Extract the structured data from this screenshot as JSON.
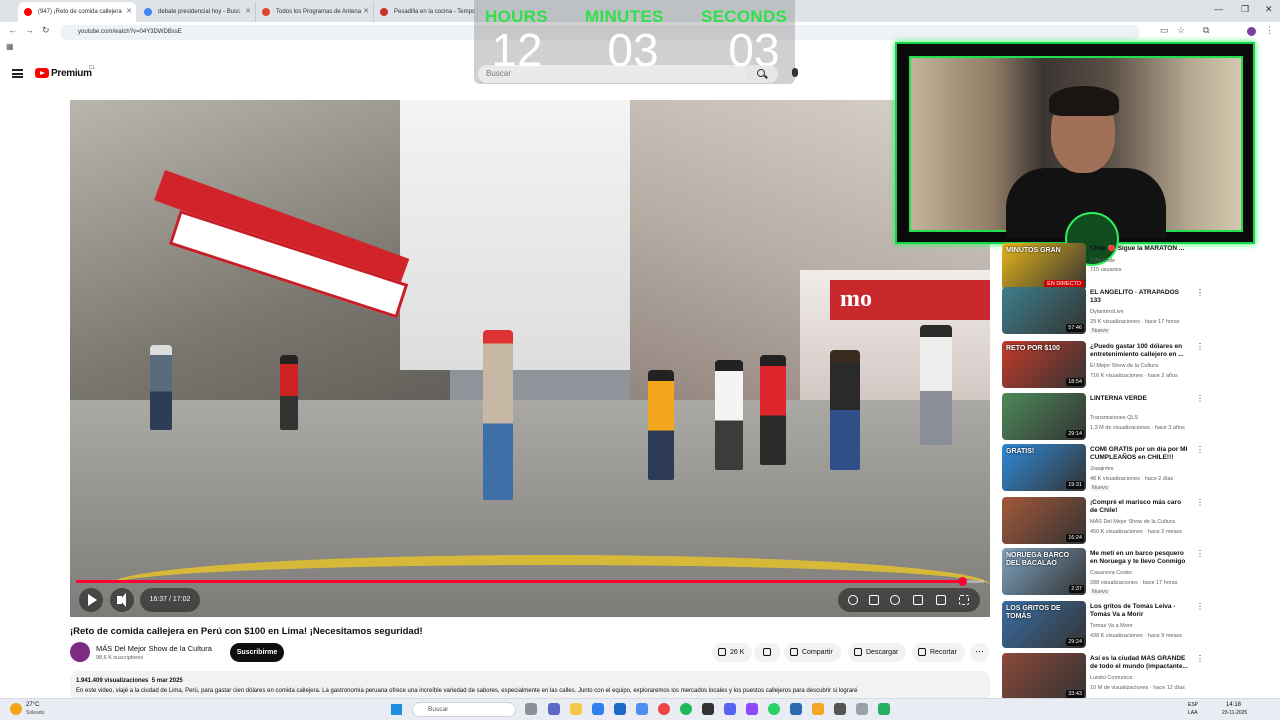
{
  "browser": {
    "tabs": [
      {
        "label": "(947) ¡Reto de comida callejera",
        "icon_color": "#ff0000",
        "active": true
      },
      {
        "label": "debate presidencial hoy - Busc",
        "icon_color": "#4285f4",
        "active": false
      },
      {
        "label": "Todos los Programas de Antena",
        "icon_color": "#e0442a",
        "active": false
      },
      {
        "label": "Pesadilla en la cocina - Tempo",
        "icon_color": "#d0312d",
        "active": false
      }
    ],
    "url": "youtube.com/watch?v=04Y3DWDBssE"
  },
  "youtube": {
    "logo_text": "Premium",
    "country_code": "CL",
    "search_placeholder": "Buscar"
  },
  "timer": {
    "hours_label": "HOURS",
    "minutes_label": "MINUTES",
    "seconds_label": "SECONDS",
    "hours": "12",
    "minutes": "03",
    "seconds": "03"
  },
  "player": {
    "time_display": "16:37 / 17:02",
    "progress_fraction": 0.976,
    "store_sign_right": "mo"
  },
  "video": {
    "title": "¡Reto de comida callejera en Perú con $100 en Lima! ¡Necesitamos seguridad!",
    "channel": "MÁS Del Mejor Show de la Cultura",
    "subscribers": "98,6 K suscriptores",
    "subscribe_label": "Suscribirme",
    "likes": "26 K",
    "share_label": "Compartir",
    "download_label": "Descargar",
    "clip_label": "Recortar",
    "views": "1.941.409 visualizaciones",
    "date": "5 mar 2025",
    "description": "En este video, viajé a la ciudad de Lima, Perú, para gastar cien dólares en comida callejera. La gastronomía peruana ofrece una increíble variedad de sabores, especialmente en las calles. Junto con el equipo, exploraremos los mercados locales y los puestos callejeros para descubrir si lograré"
  },
  "sidebar": {
    "items": [
      {
        "title": "Chile 🔴 Sigue la MARATÓN ...",
        "channel": "TVN Chile",
        "meta": "715 usuarios",
        "duration": "",
        "badge": "",
        "thumb_color": "#e7b51b",
        "live": "EN DIRECTO",
        "thumb_text": "MINUTOS GRAN"
      },
      {
        "title": "EL ANGELITO · ATRAPADOS 133",
        "channel": "DylantéroLive",
        "meta": "29 K visualizaciones · hace 17 horas",
        "duration": "57:46",
        "badge": "Nuevo",
        "thumb_color": "#3d7f8c",
        "live": "",
        "thumb_text": ""
      },
      {
        "title": "¿Puedo gastar 100 dólares en entretenimiento callejero en ...",
        "channel": "El Mejor Show de la Cultura",
        "meta": "716 K visualizaciones · hace 2 años",
        "duration": "18:54",
        "badge": "",
        "thumb_color": "#c33b2a",
        "live": "",
        "thumb_text": "RETO POR $100"
      },
      {
        "title": "LINTERNA VERDE",
        "channel": "Transmisiones QLS",
        "meta": "1,3 M de visualizaciones · hace 3 años",
        "duration": "29:14",
        "badge": "",
        "thumb_color": "#4d8a5a",
        "live": "",
        "thumb_text": ""
      },
      {
        "title": "COMÍ GRATIS por un día por MI CUMPLEAÑOS en CHILE!!!",
        "channel": "Joaqinfex",
        "meta": "48 K visualizaciones · hace 2 días",
        "duration": "19:31",
        "badge": "Nuevo",
        "thumb_color": "#2f8ad8",
        "live": "",
        "thumb_text": "GRATIS!"
      },
      {
        "title": "¡Compré el marisco más caro de Chile!",
        "channel": "MÁS Del Mejor Show de la Cultura",
        "meta": "450 K visualizaciones · hace 2 meses",
        "duration": "16:24",
        "badge": "",
        "thumb_color": "#a3583a",
        "live": "",
        "thumb_text": ""
      },
      {
        "title": "Me metí en un barco pesquero en Noruega y te llevo Conmigo",
        "channel": "Casanova Cooks",
        "meta": "288 visualizaciones · hace 17 horas",
        "duration": "2:37",
        "badge": "Nuevo",
        "thumb_color": "#7fa3c2",
        "live": "",
        "thumb_text": "NORUEGA BARCO DEL BACALAO"
      },
      {
        "title": "Los gritos de Tomás Leiva - Tomás Va a Morir",
        "channel": "Tomas Va a Morir",
        "meta": "438 K visualizaciones · hace 9 meses",
        "duration": "29:24",
        "badge": "",
        "thumb_color": "#3a6ea5",
        "live": "",
        "thumb_text": "LOS GRITOS DE TOMÁS"
      },
      {
        "title": "Así es la ciudad MÁS GRANDE de todo el mundo (impactante...",
        "channel": "Luisito Comunica",
        "meta": "10 M de visualizaciones · hace 12 días",
        "duration": "33:43",
        "badge": "",
        "thumb_color": "#8c4a3a",
        "live": "",
        "thumb_text": ""
      }
    ]
  },
  "taskbar": {
    "temperature": "27°C",
    "condition": "Soleado",
    "search_placeholder": "Buscar",
    "lang_1": "ESP",
    "lang_2": "LAA",
    "time": "14:18",
    "date": "23-11-2025"
  }
}
